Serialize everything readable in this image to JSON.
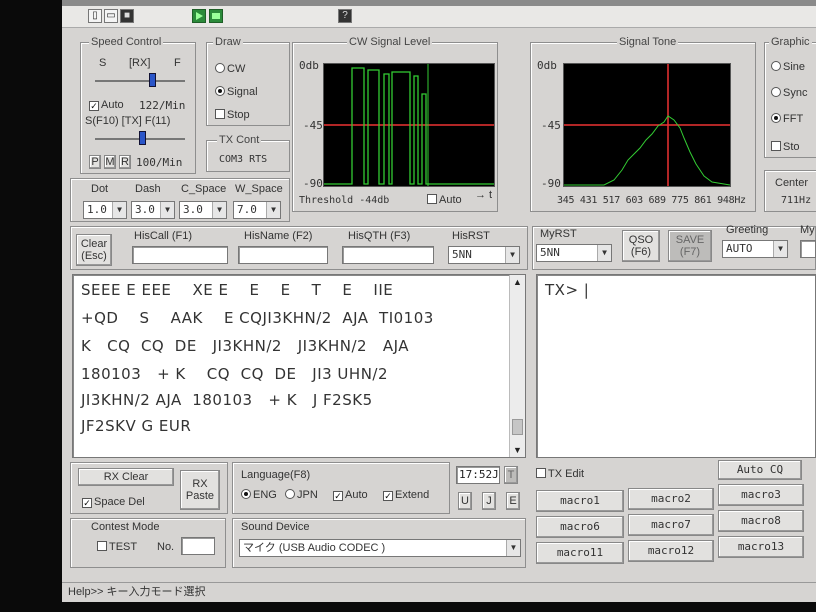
{
  "toolbar": {
    "title": "",
    "icons": [
      "new-file-icon",
      "open-folder-icon",
      "save-icon",
      "play-icon",
      "monitor-icon",
      "help-icon"
    ]
  },
  "speed_control": {
    "legend": "Speed Control",
    "s_label": "S",
    "rx_label": "[RX]",
    "f_label": "F",
    "auto_label": "Auto",
    "rx_speed": "122/Min",
    "tx_label_row": "S(F10)  [TX]  F(11)",
    "p_label": "P",
    "m_label": "M",
    "r_label": "R",
    "tx_speed": "100/Min",
    "auto_checked": true
  },
  "draw": {
    "legend": "Draw",
    "options": [
      "CW",
      "Signal",
      "Stop"
    ],
    "selected": "Signal"
  },
  "tx_cont": {
    "legend": "TX Cont",
    "value": "COM3 RTS"
  },
  "cw_signal": {
    "legend": "CW Signal Level",
    "y_top": "0db",
    "y_mid": "-45",
    "y_bottom": "-90",
    "threshold": "Threshold -44db",
    "auto_label": "Auto",
    "x_axis_label": "→ t"
  },
  "signal_tone": {
    "legend": "Signal Tone",
    "y_top": "0db",
    "y_mid": "-45",
    "y_bottom": "-90",
    "freq_ticks": "345 431 517 603 689 775 861 948Hz"
  },
  "graphic": {
    "legend": "Graphic",
    "options": [
      "Sine",
      "Sync",
      "FFT"
    ],
    "selected": "FFT",
    "stop_label": "Sto",
    "center_label": "Center",
    "center_value": "711Hz"
  },
  "timing": {
    "dot_label": "Dot",
    "dash_label": "Dash",
    "cspace_label": "C_Space",
    "wspace_label": "W_Space",
    "dot": "1.0",
    "dash": "3.0",
    "cspace": "3.0",
    "wspace": "7.0"
  },
  "log": {
    "clear_label": "Clear\n(Esc)",
    "hiscall_label": "HisCall (F1)",
    "hisname_label": "HisName (F2)",
    "hisqth_label": "HisQTH (F3)",
    "hisrst_label": "HisRST",
    "hisrst_value": "5NN",
    "myrst_label": "MyRST",
    "myrst_value": "5NN",
    "qso_label": "QSO\n(F6)",
    "save_label": "SAVE\n(F7)",
    "greeting_label": "Greeting",
    "greeting_value": "AUTO",
    "my_label": "My"
  },
  "rx_text": {
    "lines": [
      "SEEE E EEE    XE E    E    E    T    E    IIE",
      "+QD    S    AAK    E CQJI3KHN/2  AJA  TI0103",
      "K   CQ  CQ  DE   JI3KHN/2   JI3KHN/2   AJA",
      "180103   + K    CQ  CQ  DE   JI3 UHN/2",
      "JI3KHN/2 AJA  180103   + K   J F2SK5",
      "JF2SKV G EUR"
    ]
  },
  "tx_text": {
    "prompt": "TX> |"
  },
  "bottom": {
    "rx_clear": "RX Clear",
    "rx_paste": "RX\nPaste",
    "space_del": "Space Del",
    "space_del_checked": true,
    "language_label": "Language(F8)",
    "lang_eng": "ENG",
    "lang_jpn": "JPN",
    "lang_selected": "ENG",
    "auto_label": "Auto",
    "extend_label": "Extend",
    "time": "17:52J",
    "t_btn": "T",
    "u_btn": "U",
    "j_btn": "J",
    "e_btn": "E",
    "tx_edit": "TX Edit",
    "contest_label": "Contest Mode",
    "test_label": "TEST",
    "no_label": "No.",
    "sound_label": "Sound Device",
    "sound_value": "マイク (USB Audio CODEC )",
    "auto_cq": "Auto CQ",
    "macros": [
      "macro1",
      "macro2",
      "macro3",
      "macro6",
      "macro7",
      "macro8",
      "macro11",
      "macro12",
      "macro13"
    ]
  },
  "status": {
    "text": "Help>> キー入力モード選択"
  }
}
